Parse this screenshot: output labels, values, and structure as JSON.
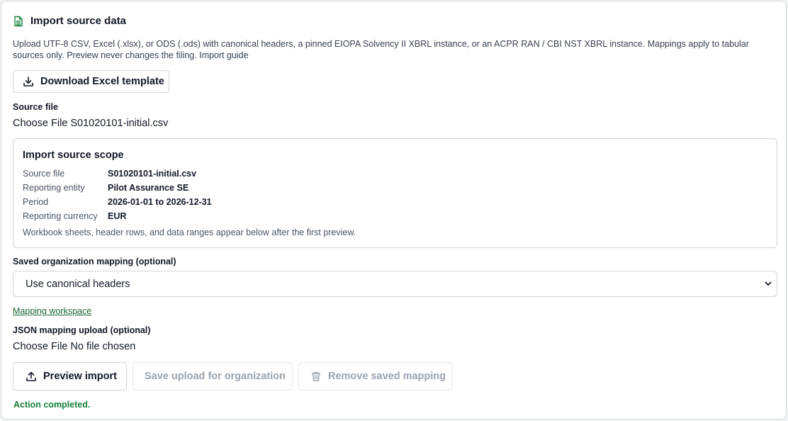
{
  "header": {
    "title": "Import source data",
    "icon": "document-sheet-icon"
  },
  "intro": "Upload UTF-8 CSV, Excel (.xlsx), or ODS (.ods) with canonical headers, a pinned EIOPA Solvency II XBRL instance, or an ACPR RAN / CBI NST XBRL instance. Mappings apply to tabular sources only. Preview never changes the filing. Import guide",
  "download_button": {
    "label": "Download Excel template",
    "icon": "download-icon"
  },
  "source_file": {
    "label": "Source file",
    "choose_label": "Choose File",
    "file_name": "S01020101-initial.csv"
  },
  "scope": {
    "title": "Import source scope",
    "rows": [
      {
        "key": "Source file",
        "value": "S01020101-initial.csv"
      },
      {
        "key": "Reporting entity",
        "value": "Pilot Assurance SE"
      },
      {
        "key": "Period",
        "value": "2026-01-01 to 2026-12-31"
      },
      {
        "key": "Reporting currency",
        "value": "EUR"
      }
    ],
    "note": "Workbook sheets, header rows, and data ranges appear below after the first preview."
  },
  "mapping": {
    "label": "Saved organization mapping (optional)",
    "selected": "Use canonical headers",
    "workspace_link": "Mapping workspace"
  },
  "json_mapping": {
    "label": "JSON mapping upload (optional)",
    "choose_label": "Choose File",
    "file_name": "No file chosen"
  },
  "actions": {
    "preview_label": "Preview import",
    "save_label": "Save upload for organization",
    "remove_label": "Remove saved mapping"
  },
  "status": "Action completed.",
  "colors": {
    "accent_green": "#166534",
    "status_green": "#15803d",
    "disabled_text": "#9ca3af",
    "border": "#d1d5db"
  }
}
